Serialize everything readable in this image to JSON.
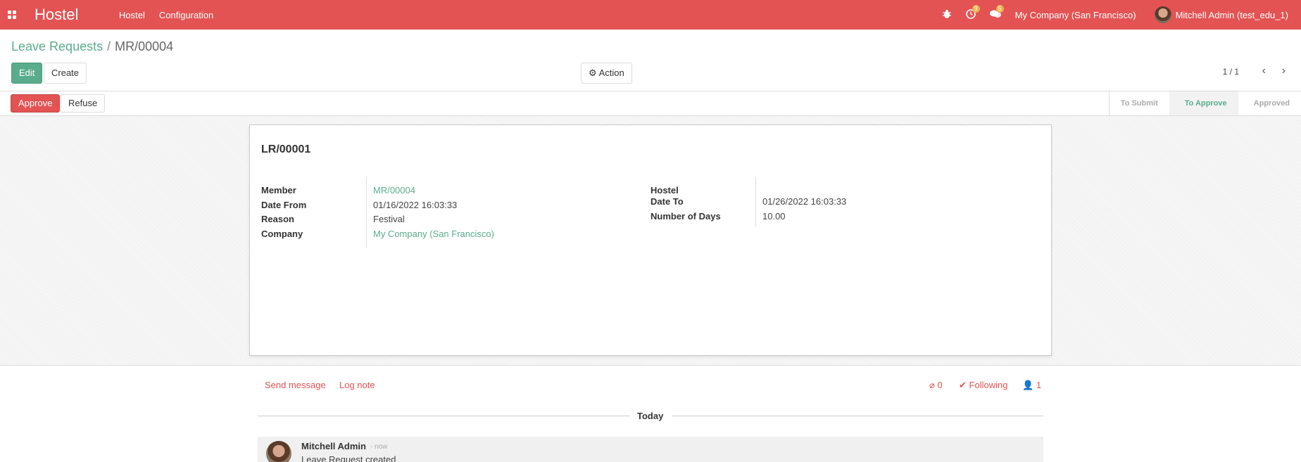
{
  "navbar": {
    "brand": "Hostel",
    "menu": [
      "Hostel",
      "Configuration"
    ],
    "activity_count": "9",
    "message_count": "5",
    "company": "My Company (San Francisco)",
    "user": "Mitchell Admin (test_edu_1)"
  },
  "breadcrumb": {
    "parent": "Leave Requests",
    "current": "MR/00004"
  },
  "toolbar": {
    "edit_label": "Edit",
    "create_label": "Create",
    "action_label": "Action",
    "pager": "1 / 1"
  },
  "statusbar": {
    "approve_label": "Approve",
    "refuse_label": "Refuse",
    "stages": [
      "To Submit",
      "To Approve",
      "Approved"
    ],
    "active_stage": "To Approve"
  },
  "record": {
    "title": "LR/00001",
    "left_fields": [
      {
        "label": "Member",
        "value": "MR/00004",
        "link": true
      },
      {
        "label": "Date From",
        "value": "01/16/2022 16:03:33",
        "link": false
      },
      {
        "label": "Reason",
        "value": "Festival",
        "link": false
      },
      {
        "label": "Company",
        "value": "My Company (San Francisco)",
        "link": true
      }
    ],
    "right_fields": [
      {
        "label": "Hostel",
        "value": ""
      },
      {
        "label": "Date To",
        "value": "01/26/2022 16:03:33"
      },
      {
        "label": "Number of Days",
        "value": "10.00"
      }
    ]
  },
  "chatter": {
    "send_message": "Send message",
    "log_note": "Log note",
    "attachments": "0",
    "following": "Following",
    "followers": "1",
    "today": "Today",
    "message": {
      "author": "Mitchell Admin",
      "time": "- now",
      "body": "Leave Request created"
    }
  },
  "colors": {
    "brand": "#e35353",
    "primary": "#5aac8c"
  }
}
